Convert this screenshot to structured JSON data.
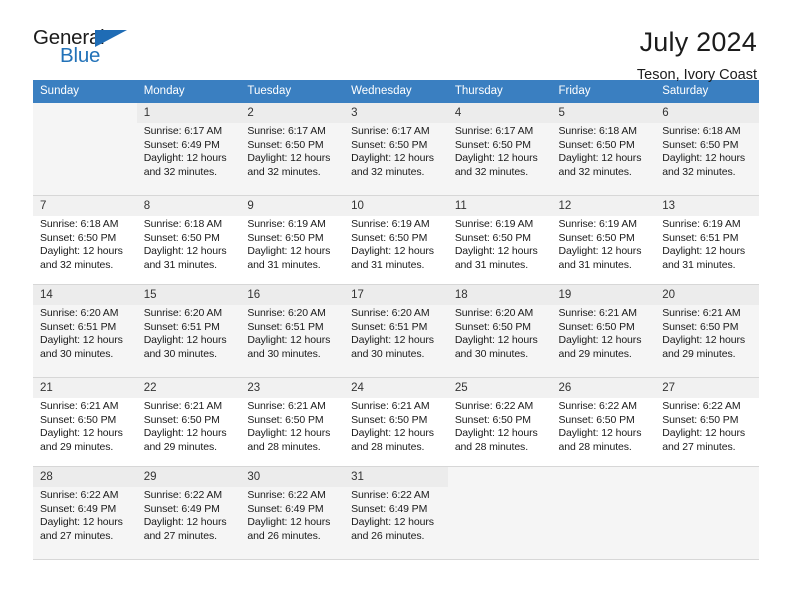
{
  "brand": {
    "name_part1": "General",
    "name_part2": "Blue"
  },
  "header": {
    "title": "July 2024",
    "subtitle": "Teson, Ivory Coast"
  },
  "colors": {
    "header_blue": "#3a7fc1",
    "brand_blue": "#2272b8",
    "row_shade": "#f5f5f5",
    "daynum_shade": "#f1f1f1"
  },
  "calendar": {
    "weekday_headers": [
      "Sunday",
      "Monday",
      "Tuesday",
      "Wednesday",
      "Thursday",
      "Friday",
      "Saturday"
    ],
    "weeks": [
      [
        {
          "day": "",
          "sunrise": "",
          "sunset": "",
          "daylight_line1": "",
          "daylight_line2": ""
        },
        {
          "day": "1",
          "sunrise": "Sunrise: 6:17 AM",
          "sunset": "Sunset: 6:49 PM",
          "daylight_line1": "Daylight: 12 hours",
          "daylight_line2": "and 32 minutes."
        },
        {
          "day": "2",
          "sunrise": "Sunrise: 6:17 AM",
          "sunset": "Sunset: 6:50 PM",
          "daylight_line1": "Daylight: 12 hours",
          "daylight_line2": "and 32 minutes."
        },
        {
          "day": "3",
          "sunrise": "Sunrise: 6:17 AM",
          "sunset": "Sunset: 6:50 PM",
          "daylight_line1": "Daylight: 12 hours",
          "daylight_line2": "and 32 minutes."
        },
        {
          "day": "4",
          "sunrise": "Sunrise: 6:17 AM",
          "sunset": "Sunset: 6:50 PM",
          "daylight_line1": "Daylight: 12 hours",
          "daylight_line2": "and 32 minutes."
        },
        {
          "day": "5",
          "sunrise": "Sunrise: 6:18 AM",
          "sunset": "Sunset: 6:50 PM",
          "daylight_line1": "Daylight: 12 hours",
          "daylight_line2": "and 32 minutes."
        },
        {
          "day": "6",
          "sunrise": "Sunrise: 6:18 AM",
          "sunset": "Sunset: 6:50 PM",
          "daylight_line1": "Daylight: 12 hours",
          "daylight_line2": "and 32 minutes."
        }
      ],
      [
        {
          "day": "7",
          "sunrise": "Sunrise: 6:18 AM",
          "sunset": "Sunset: 6:50 PM",
          "daylight_line1": "Daylight: 12 hours",
          "daylight_line2": "and 32 minutes."
        },
        {
          "day": "8",
          "sunrise": "Sunrise: 6:18 AM",
          "sunset": "Sunset: 6:50 PM",
          "daylight_line1": "Daylight: 12 hours",
          "daylight_line2": "and 31 minutes."
        },
        {
          "day": "9",
          "sunrise": "Sunrise: 6:19 AM",
          "sunset": "Sunset: 6:50 PM",
          "daylight_line1": "Daylight: 12 hours",
          "daylight_line2": "and 31 minutes."
        },
        {
          "day": "10",
          "sunrise": "Sunrise: 6:19 AM",
          "sunset": "Sunset: 6:50 PM",
          "daylight_line1": "Daylight: 12 hours",
          "daylight_line2": "and 31 minutes."
        },
        {
          "day": "11",
          "sunrise": "Sunrise: 6:19 AM",
          "sunset": "Sunset: 6:50 PM",
          "daylight_line1": "Daylight: 12 hours",
          "daylight_line2": "and 31 minutes."
        },
        {
          "day": "12",
          "sunrise": "Sunrise: 6:19 AM",
          "sunset": "Sunset: 6:50 PM",
          "daylight_line1": "Daylight: 12 hours",
          "daylight_line2": "and 31 minutes."
        },
        {
          "day": "13",
          "sunrise": "Sunrise: 6:19 AM",
          "sunset": "Sunset: 6:51 PM",
          "daylight_line1": "Daylight: 12 hours",
          "daylight_line2": "and 31 minutes."
        }
      ],
      [
        {
          "day": "14",
          "sunrise": "Sunrise: 6:20 AM",
          "sunset": "Sunset: 6:51 PM",
          "daylight_line1": "Daylight: 12 hours",
          "daylight_line2": "and 30 minutes."
        },
        {
          "day": "15",
          "sunrise": "Sunrise: 6:20 AM",
          "sunset": "Sunset: 6:51 PM",
          "daylight_line1": "Daylight: 12 hours",
          "daylight_line2": "and 30 minutes."
        },
        {
          "day": "16",
          "sunrise": "Sunrise: 6:20 AM",
          "sunset": "Sunset: 6:51 PM",
          "daylight_line1": "Daylight: 12 hours",
          "daylight_line2": "and 30 minutes."
        },
        {
          "day": "17",
          "sunrise": "Sunrise: 6:20 AM",
          "sunset": "Sunset: 6:51 PM",
          "daylight_line1": "Daylight: 12 hours",
          "daylight_line2": "and 30 minutes."
        },
        {
          "day": "18",
          "sunrise": "Sunrise: 6:20 AM",
          "sunset": "Sunset: 6:50 PM",
          "daylight_line1": "Daylight: 12 hours",
          "daylight_line2": "and 30 minutes."
        },
        {
          "day": "19",
          "sunrise": "Sunrise: 6:21 AM",
          "sunset": "Sunset: 6:50 PM",
          "daylight_line1": "Daylight: 12 hours",
          "daylight_line2": "and 29 minutes."
        },
        {
          "day": "20",
          "sunrise": "Sunrise: 6:21 AM",
          "sunset": "Sunset: 6:50 PM",
          "daylight_line1": "Daylight: 12 hours",
          "daylight_line2": "and 29 minutes."
        }
      ],
      [
        {
          "day": "21",
          "sunrise": "Sunrise: 6:21 AM",
          "sunset": "Sunset: 6:50 PM",
          "daylight_line1": "Daylight: 12 hours",
          "daylight_line2": "and 29 minutes."
        },
        {
          "day": "22",
          "sunrise": "Sunrise: 6:21 AM",
          "sunset": "Sunset: 6:50 PM",
          "daylight_line1": "Daylight: 12 hours",
          "daylight_line2": "and 29 minutes."
        },
        {
          "day": "23",
          "sunrise": "Sunrise: 6:21 AM",
          "sunset": "Sunset: 6:50 PM",
          "daylight_line1": "Daylight: 12 hours",
          "daylight_line2": "and 28 minutes."
        },
        {
          "day": "24",
          "sunrise": "Sunrise: 6:21 AM",
          "sunset": "Sunset: 6:50 PM",
          "daylight_line1": "Daylight: 12 hours",
          "daylight_line2": "and 28 minutes."
        },
        {
          "day": "25",
          "sunrise": "Sunrise: 6:22 AM",
          "sunset": "Sunset: 6:50 PM",
          "daylight_line1": "Daylight: 12 hours",
          "daylight_line2": "and 28 minutes."
        },
        {
          "day": "26",
          "sunrise": "Sunrise: 6:22 AM",
          "sunset": "Sunset: 6:50 PM",
          "daylight_line1": "Daylight: 12 hours",
          "daylight_line2": "and 28 minutes."
        },
        {
          "day": "27",
          "sunrise": "Sunrise: 6:22 AM",
          "sunset": "Sunset: 6:50 PM",
          "daylight_line1": "Daylight: 12 hours",
          "daylight_line2": "and 27 minutes."
        }
      ],
      [
        {
          "day": "28",
          "sunrise": "Sunrise: 6:22 AM",
          "sunset": "Sunset: 6:49 PM",
          "daylight_line1": "Daylight: 12 hours",
          "daylight_line2": "and 27 minutes."
        },
        {
          "day": "29",
          "sunrise": "Sunrise: 6:22 AM",
          "sunset": "Sunset: 6:49 PM",
          "daylight_line1": "Daylight: 12 hours",
          "daylight_line2": "and 27 minutes."
        },
        {
          "day": "30",
          "sunrise": "Sunrise: 6:22 AM",
          "sunset": "Sunset: 6:49 PM",
          "daylight_line1": "Daylight: 12 hours",
          "daylight_line2": "and 26 minutes."
        },
        {
          "day": "31",
          "sunrise": "Sunrise: 6:22 AM",
          "sunset": "Sunset: 6:49 PM",
          "daylight_line1": "Daylight: 12 hours",
          "daylight_line2": "and 26 minutes."
        },
        {
          "day": "",
          "sunrise": "",
          "sunset": "",
          "daylight_line1": "",
          "daylight_line2": ""
        },
        {
          "day": "",
          "sunrise": "",
          "sunset": "",
          "daylight_line1": "",
          "daylight_line2": ""
        },
        {
          "day": "",
          "sunrise": "",
          "sunset": "",
          "daylight_line1": "",
          "daylight_line2": ""
        }
      ]
    ]
  }
}
